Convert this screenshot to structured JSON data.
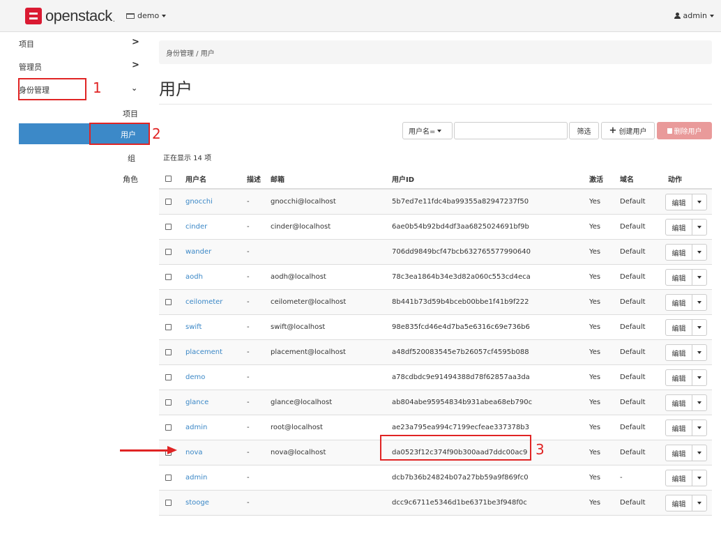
{
  "topbar": {
    "brand": "openstack",
    "project": "demo",
    "user": "admin"
  },
  "sidebar": {
    "top_items": [
      {
        "label": "项目",
        "expanded": false
      },
      {
        "label": "管理员",
        "expanded": false
      },
      {
        "label": "身份管理",
        "expanded": true
      }
    ],
    "sub_items": [
      {
        "label": "项目"
      },
      {
        "label": "用户",
        "active": true
      },
      {
        "label": "组"
      },
      {
        "label": "角色"
      }
    ]
  },
  "annotations": {
    "n1": "1",
    "n2": "2",
    "n3": "3"
  },
  "breadcrumb": "身份管理 / 用户",
  "page_title": "用户",
  "toolbar": {
    "filter_field": "用户名=",
    "filter_value": "",
    "filter_button": "筛选",
    "create_button": "创建用户",
    "delete_button": "删除用户"
  },
  "count_text": "正在显示 14 项",
  "table": {
    "headers": [
      "用户名",
      "描述",
      "邮箱",
      "用户ID",
      "激活",
      "域名",
      "动作"
    ],
    "edit_label": "编辑",
    "rows": [
      {
        "name": "gnocchi",
        "desc": "-",
        "email": "gnocchi@localhost",
        "id": "5b7ed7e11fdc4ba99355a82947237f50",
        "enabled": "Yes",
        "domain": "Default"
      },
      {
        "name": "cinder",
        "desc": "-",
        "email": "cinder@localhost",
        "id": "6ae0b54b92bd4df3aa6825024691bf9b",
        "enabled": "Yes",
        "domain": "Default"
      },
      {
        "name": "wander",
        "desc": "-",
        "email": "",
        "id": "706dd9849bcf47bcb632765577990640",
        "enabled": "Yes",
        "domain": "Default"
      },
      {
        "name": "aodh",
        "desc": "-",
        "email": "aodh@localhost",
        "id": "78c3ea1864b34e3d82a060c553cd4eca",
        "enabled": "Yes",
        "domain": "Default"
      },
      {
        "name": "ceilometer",
        "desc": "-",
        "email": "ceilometer@localhost",
        "id": "8b441b73d59b4bceb00bbe1f41b9f222",
        "enabled": "Yes",
        "domain": "Default"
      },
      {
        "name": "swift",
        "desc": "-",
        "email": "swift@localhost",
        "id": "98e835fcd46e4d7ba5e6316c69e736b6",
        "enabled": "Yes",
        "domain": "Default"
      },
      {
        "name": "placement",
        "desc": "-",
        "email": "placement@localhost",
        "id": "a48df520083545e7b26057cf4595b088",
        "enabled": "Yes",
        "domain": "Default"
      },
      {
        "name": "demo",
        "desc": "-",
        "email": "",
        "id": "a78cdbdc9e91494388d78f62857aa3da",
        "enabled": "Yes",
        "domain": "Default"
      },
      {
        "name": "glance",
        "desc": "-",
        "email": "glance@localhost",
        "id": "ab804abe95954834b931abea68eb790c",
        "enabled": "Yes",
        "domain": "Default"
      },
      {
        "name": "admin",
        "desc": "-",
        "email": "root@localhost",
        "id": "ae23a795ea994c7199ecfeae337378b3",
        "enabled": "Yes",
        "domain": "Default"
      },
      {
        "name": "nova",
        "desc": "-",
        "email": "nova@localhost",
        "id": "da0523f12c374f90b300aad7ddc00ac9",
        "enabled": "Yes",
        "domain": "Default"
      },
      {
        "name": "admin",
        "desc": "-",
        "email": "",
        "id": "dcb7b36b24824b07a27bb59a9f869fc0",
        "enabled": "Yes",
        "domain": "-"
      },
      {
        "name": "stooge",
        "desc": "-",
        "email": "",
        "id": "dcc9c6711e5346d1be6371be3f948f0c",
        "enabled": "Yes",
        "domain": "Default"
      }
    ]
  },
  "colors": {
    "accent": "#3c89c8",
    "link": "#3a87c6",
    "annotation": "#e02424",
    "danger_button": "#e99a9a"
  }
}
